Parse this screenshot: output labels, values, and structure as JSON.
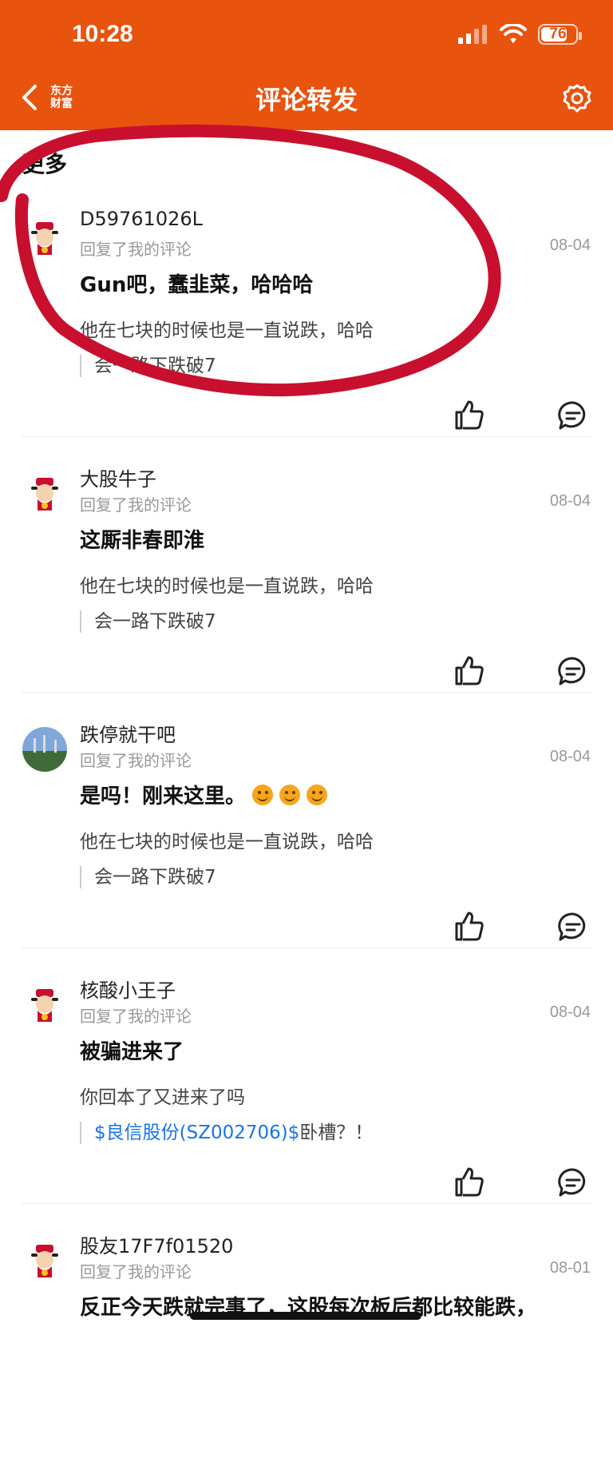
{
  "status_bar": {
    "time": "10:28",
    "battery": "76"
  },
  "header": {
    "logo_text": "东方财富",
    "title": "评论转发"
  },
  "tab_peek": "更多",
  "comments": [
    {
      "username": "D59761026L",
      "subtitle": "回复了我的评论",
      "date": "08-04",
      "comment": "Gun吧，蠢韭菜，哈哈哈",
      "original": "他在七块的时候也是一直说跌，哈哈",
      "quote": "会一路下跌破7"
    },
    {
      "username": "大股牛子",
      "subtitle": "回复了我的评论",
      "date": "08-04",
      "comment": "这厮非春即淮",
      "original": "他在七块的时候也是一直说跌，哈哈",
      "quote": "会一路下跌破7"
    },
    {
      "username": "跌停就干吧",
      "subtitle": "回复了我的评论",
      "date": "08-04",
      "comment": "是吗！刚来这里。",
      "original": "他在七块的时候也是一直说跌，哈哈",
      "quote": "会一路下跌破7"
    },
    {
      "username": "核酸小王子",
      "subtitle": "回复了我的评论",
      "date": "08-04",
      "comment": "被骗进来了",
      "original": "你回本了又进来了吗",
      "quote_link": "$良信股份(SZ002706)$",
      "quote": "卧槽？！"
    },
    {
      "username": "股友17F7f01520",
      "subtitle": "回复了我的评论",
      "date": "08-01",
      "comment": "反正今天跌就完事了，这股每次板后都比较能跌，"
    }
  ],
  "colors": {
    "header_bg": "#E8530E",
    "annotation_red": "#C8102E",
    "link_blue": "#1a73e8"
  }
}
